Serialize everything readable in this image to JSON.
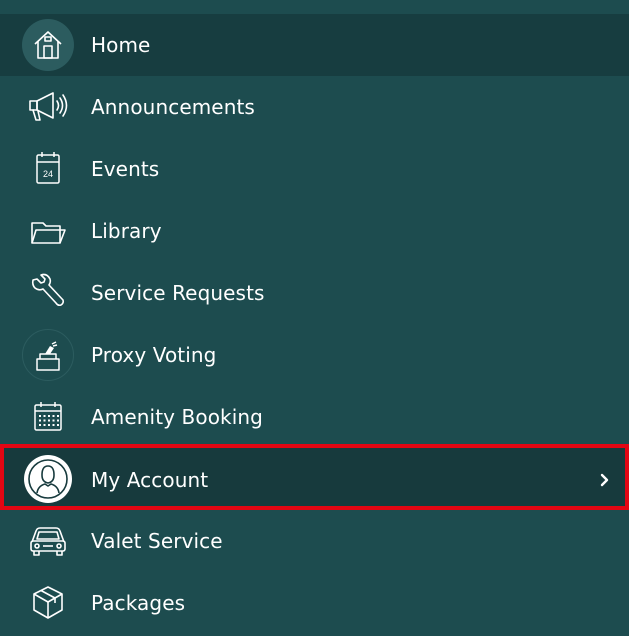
{
  "menu": {
    "items": [
      {
        "id": "home",
        "label": "Home",
        "icon": "home-icon"
      },
      {
        "id": "announcements",
        "label": "Announcements",
        "icon": "megaphone-icon"
      },
      {
        "id": "events",
        "label": "Events",
        "icon": "calendar-24-icon",
        "icon_text": "24"
      },
      {
        "id": "library",
        "label": "Library",
        "icon": "folder-icon"
      },
      {
        "id": "service-requests",
        "label": "Service Requests",
        "icon": "wrench-icon"
      },
      {
        "id": "proxy-voting",
        "label": "Proxy Voting",
        "icon": "ballot-box-icon"
      },
      {
        "id": "amenity-booking",
        "label": "Amenity Booking",
        "icon": "calendar-grid-icon"
      },
      {
        "id": "my-account",
        "label": "My Account",
        "icon": "user-avatar-icon",
        "has_submenu": true
      },
      {
        "id": "valet-service",
        "label": "Valet Service",
        "icon": "car-icon"
      },
      {
        "id": "packages",
        "label": "Packages",
        "icon": "package-box-icon"
      }
    ],
    "active_item": "home",
    "highlighted_item": "my-account"
  },
  "colors": {
    "background": "#1d4c4f",
    "active_background": "#173d40",
    "icon_circle": "#2c5c5f",
    "text": "#ffffff",
    "highlight_border": "#e30613"
  }
}
